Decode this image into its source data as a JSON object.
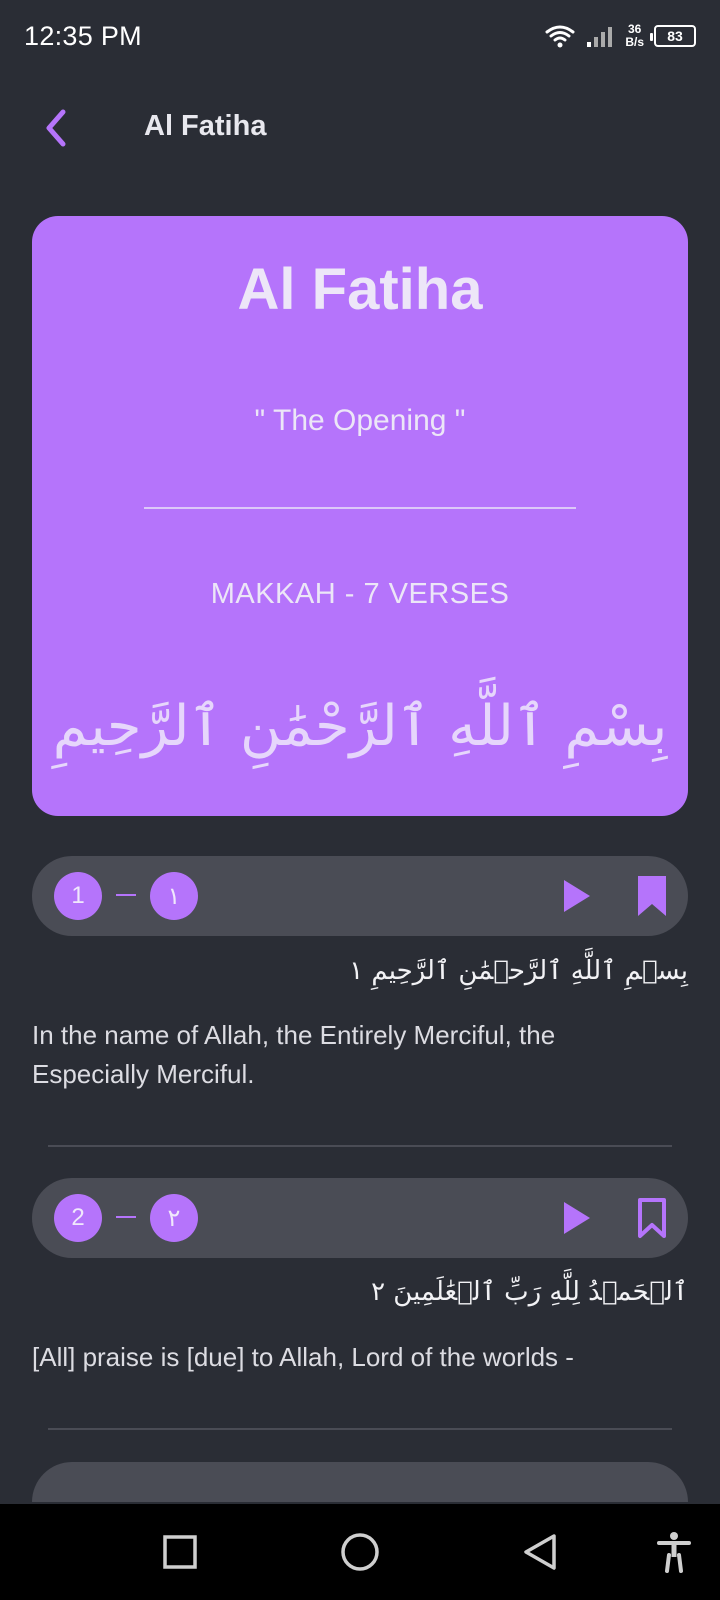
{
  "status_bar": {
    "time": "12:35 PM",
    "net_speed_value": "36",
    "net_speed_unit": "B/s",
    "battery": "83"
  },
  "header": {
    "title": "Al Fatiha",
    "back_icon": "chevron-left-icon"
  },
  "hero": {
    "title": "Al Fatiha",
    "subtitle": "\" The Opening \"",
    "meta": "MAKKAH - 7 VERSES",
    "basmala": "بِسْمِ ٱللَّهِ ٱلرَّحْمَٰنِ ٱلرَّحِيمِ"
  },
  "verses": [
    {
      "number": "1",
      "arabic_number": "١",
      "arabic": "بِسۡمِ ٱللَّهِ ٱلرَّحۡمَٰنِ ٱلرَّحِيمِ ١",
      "translation": "In the name of Allah, the Entirely Merciful, the Especially Merciful."
    },
    {
      "number": "2",
      "arabic_number": "٢",
      "arabic": "ٱلۡحَمۡدُ لِلَّهِ رَبِّ ٱلۡعَٰلَمِينَ ٢",
      "translation": "[All] praise is [due] to Allah, Lord of the worlds -"
    }
  ],
  "colors": {
    "accent": "#b574fb",
    "background": "#2a2d35",
    "card": "#4a4c55"
  },
  "nav": {
    "recents_icon": "square-icon",
    "home_icon": "circle-icon",
    "back_icon": "triangle-back-icon",
    "accessibility_icon": "accessibility-icon"
  }
}
